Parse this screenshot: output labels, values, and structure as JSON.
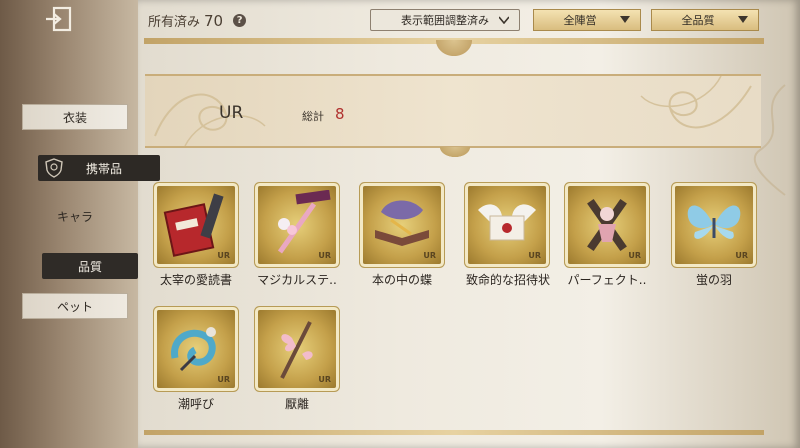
{
  "header": {
    "owned_label": "所有済み",
    "owned_count": "70",
    "help_glyph": "?",
    "filters": [
      {
        "label": "表示範囲調整済み"
      },
      {
        "label": "全陣営"
      },
      {
        "label": "全品質"
      }
    ]
  },
  "sidebar": {
    "items": [
      {
        "label": "衣装"
      },
      {
        "label": "携帯品"
      },
      {
        "label": "キャラ"
      },
      {
        "label": "品質"
      },
      {
        "label": "ペット"
      }
    ]
  },
  "section": {
    "tier": "UR",
    "total_label": "総計",
    "total_count": "8"
  },
  "items": [
    {
      "name": "太宰の愛読書",
      "rank": "UR",
      "icon": "book-icon"
    },
    {
      "name": "マジカルステ..",
      "rank": "UR",
      "icon": "magic-staff-icon"
    },
    {
      "name": "本の中の蝶",
      "rank": "UR",
      "icon": "butterfly-book-icon"
    },
    {
      "name": "致命的な招待状",
      "rank": "UR",
      "icon": "winged-letter-icon"
    },
    {
      "name": "パーフェクト..",
      "rank": "UR",
      "icon": "cross-doll-icon"
    },
    {
      "name": "蛍の羽",
      "rank": "UR",
      "icon": "firefly-wings-icon"
    },
    {
      "name": "潮呼び",
      "rank": "UR",
      "icon": "tide-creature-icon"
    },
    {
      "name": "厭離",
      "rank": "UR",
      "icon": "pink-ribbon-staff-icon"
    }
  ],
  "colors": {
    "accent_gold": "#c4a04a",
    "count_red": "#b0322f",
    "selected_dark": "#2d2925"
  }
}
